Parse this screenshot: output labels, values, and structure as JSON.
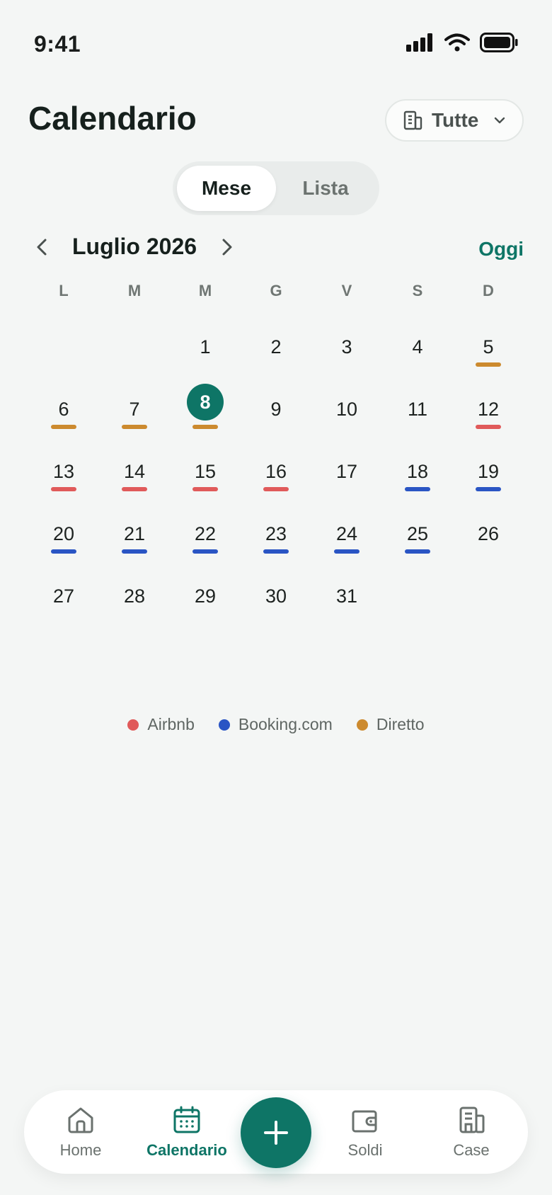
{
  "status_bar": {
    "time": "9:41"
  },
  "header": {
    "title": "Calendario",
    "filter_label": "Tutte"
  },
  "view_toggle": {
    "options": [
      "Mese",
      "Lista"
    ],
    "selected": "Mese"
  },
  "month_nav": {
    "label": "Luglio 2026",
    "today_link": "Oggi"
  },
  "weekdays": [
    "L",
    "M",
    "M",
    "G",
    "V",
    "S",
    "D"
  ],
  "calendar": {
    "leading_blanks": 2,
    "today": 8,
    "days": [
      {
        "d": "1",
        "src": ""
      },
      {
        "d": "2",
        "src": ""
      },
      {
        "d": "3",
        "src": ""
      },
      {
        "d": "4",
        "src": ""
      },
      {
        "d": "5",
        "src": "diretto"
      },
      {
        "d": "6",
        "src": "diretto"
      },
      {
        "d": "7",
        "src": "diretto"
      },
      {
        "d": "8",
        "src": "diretto"
      },
      {
        "d": "9",
        "src": ""
      },
      {
        "d": "10",
        "src": ""
      },
      {
        "d": "11",
        "src": ""
      },
      {
        "d": "12",
        "src": "airbnb"
      },
      {
        "d": "13",
        "src": "airbnb"
      },
      {
        "d": "14",
        "src": "airbnb"
      },
      {
        "d": "15",
        "src": "airbnb"
      },
      {
        "d": "16",
        "src": "airbnb"
      },
      {
        "d": "17",
        "src": ""
      },
      {
        "d": "18",
        "src": "booking"
      },
      {
        "d": "19",
        "src": "booking"
      },
      {
        "d": "20",
        "src": "booking"
      },
      {
        "d": "21",
        "src": "booking"
      },
      {
        "d": "22",
        "src": "booking"
      },
      {
        "d": "23",
        "src": "booking"
      },
      {
        "d": "24",
        "src": "booking"
      },
      {
        "d": "25",
        "src": "booking"
      },
      {
        "d": "26",
        "src": ""
      },
      {
        "d": "27",
        "src": ""
      },
      {
        "d": "28",
        "src": ""
      },
      {
        "d": "29",
        "src": ""
      },
      {
        "d": "30",
        "src": ""
      },
      {
        "d": "31",
        "src": ""
      }
    ]
  },
  "legend": [
    {
      "key": "airbnb",
      "label": "Airbnb",
      "color": "#e05a5a"
    },
    {
      "key": "booking",
      "label": "Booking.com",
      "color": "#2a55c4"
    },
    {
      "key": "diretto",
      "label": "Diretto",
      "color": "#cc8a2e"
    }
  ],
  "colors": {
    "accent": "#0e7566",
    "background": "#f4f6f5"
  },
  "bottom_nav": {
    "items": [
      {
        "label": "Home",
        "icon": "home-icon",
        "active": false
      },
      {
        "label": "Calendario",
        "icon": "calendar-icon",
        "active": true
      },
      {
        "label": "Soldi",
        "icon": "wallet-icon",
        "active": false
      },
      {
        "label": "Case",
        "icon": "building-icon",
        "active": false
      }
    ],
    "fab_icon": "plus-icon"
  }
}
